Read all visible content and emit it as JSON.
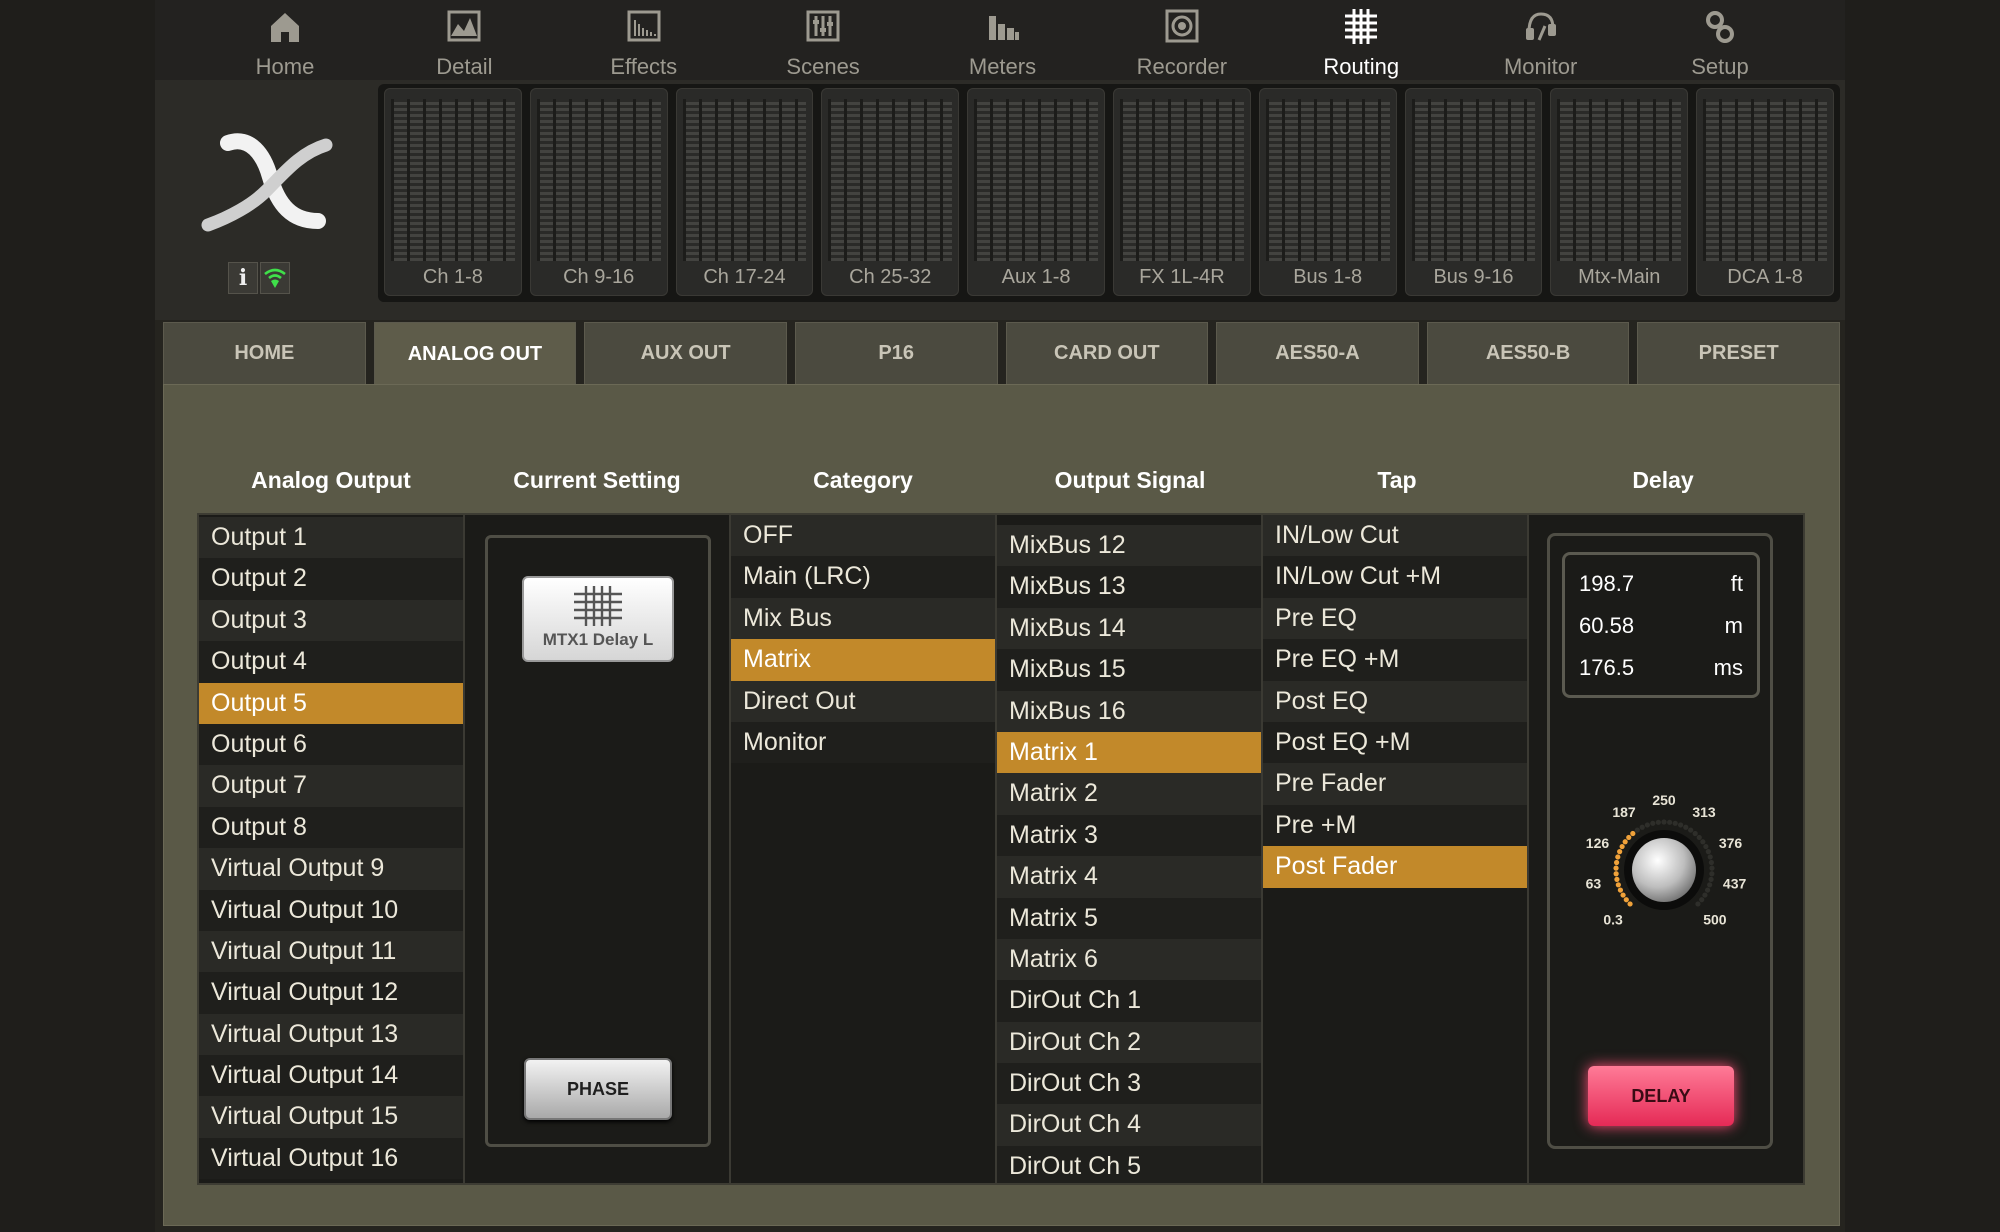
{
  "nav": [
    {
      "label": "Home",
      "icon": "home-icon"
    },
    {
      "label": "Detail",
      "icon": "detail-icon"
    },
    {
      "label": "Effects",
      "icon": "effects-icon"
    },
    {
      "label": "Scenes",
      "icon": "scenes-icon"
    },
    {
      "label": "Meters",
      "icon": "meters-icon"
    },
    {
      "label": "Recorder",
      "icon": "recorder-icon"
    },
    {
      "label": "Routing",
      "icon": "routing-icon"
    },
    {
      "label": "Monitor",
      "icon": "monitor-icon"
    },
    {
      "label": "Setup",
      "icon": "setup-icon"
    }
  ],
  "active_nav": "Routing",
  "status": {
    "info_label": "i"
  },
  "banks": [
    "Ch 1-8",
    "Ch 9-16",
    "Ch 17-24",
    "Ch 25-32",
    "Aux 1-8",
    "FX 1L-4R",
    "Bus 1-8",
    "Bus 9-16",
    "Mtx-Main",
    "DCA 1-8"
  ],
  "tabs": [
    "HOME",
    "ANALOG OUT",
    "AUX OUT",
    "P16",
    "CARD OUT",
    "AES50-A",
    "AES50-B",
    "PRESET"
  ],
  "active_tab": "ANALOG OUT",
  "columns": {
    "analog_output": "Analog Output",
    "current_setting": "Current Setting",
    "category": "Category",
    "output_signal": "Output Signal",
    "tap": "Tap",
    "delay": "Delay"
  },
  "analog_outputs": [
    "Output 1",
    "Output 2",
    "Output 3",
    "Output 4",
    "Output 5",
    "Output 6",
    "Output 7",
    "Output 8",
    "Virtual Output 9",
    "Virtual Output 10",
    "Virtual Output 11",
    "Virtual Output 12",
    "Virtual Output 13",
    "Virtual Output 14",
    "Virtual Output 15",
    "Virtual Output 16"
  ],
  "selected_output": "Output 5",
  "current_setting": {
    "button_label": "MTX1 Delay L",
    "phase_label": "PHASE"
  },
  "categories": [
    "OFF",
    "Main (LRC)",
    "Mix Bus",
    "Matrix",
    "Direct Out",
    "Monitor"
  ],
  "selected_category": "Matrix",
  "output_signals": [
    "MixBus 12",
    "MixBus 13",
    "MixBus 14",
    "MixBus 15",
    "MixBus 16",
    "Matrix 1",
    "Matrix 2",
    "Matrix 3",
    "Matrix 4",
    "Matrix 5",
    "Matrix 6",
    "DirOut Ch 1",
    "DirOut Ch 2",
    "DirOut Ch 3",
    "DirOut Ch 4",
    "DirOut Ch 5"
  ],
  "selected_signal": "Matrix 1",
  "taps": [
    "IN/Low Cut",
    "IN/Low Cut +M",
    "Pre EQ",
    "Pre EQ +M",
    "Post EQ",
    "Post EQ +M",
    "Pre Fader",
    "Pre +M",
    "Post Fader"
  ],
  "selected_tap": "Post Fader",
  "delay": {
    "readout": [
      {
        "value": "198.7",
        "unit": "ft"
      },
      {
        "value": "60.58",
        "unit": "m"
      },
      {
        "value": "176.5",
        "unit": "ms"
      }
    ],
    "dial_ticks": [
      "0.3",
      "63",
      "126",
      "187",
      "250",
      "313",
      "376",
      "437",
      "500"
    ],
    "dial_value_ms": 176.5,
    "button_label": "DELAY"
  },
  "colors": {
    "accent": "#c2892a",
    "delay_button": "#f24a71"
  }
}
